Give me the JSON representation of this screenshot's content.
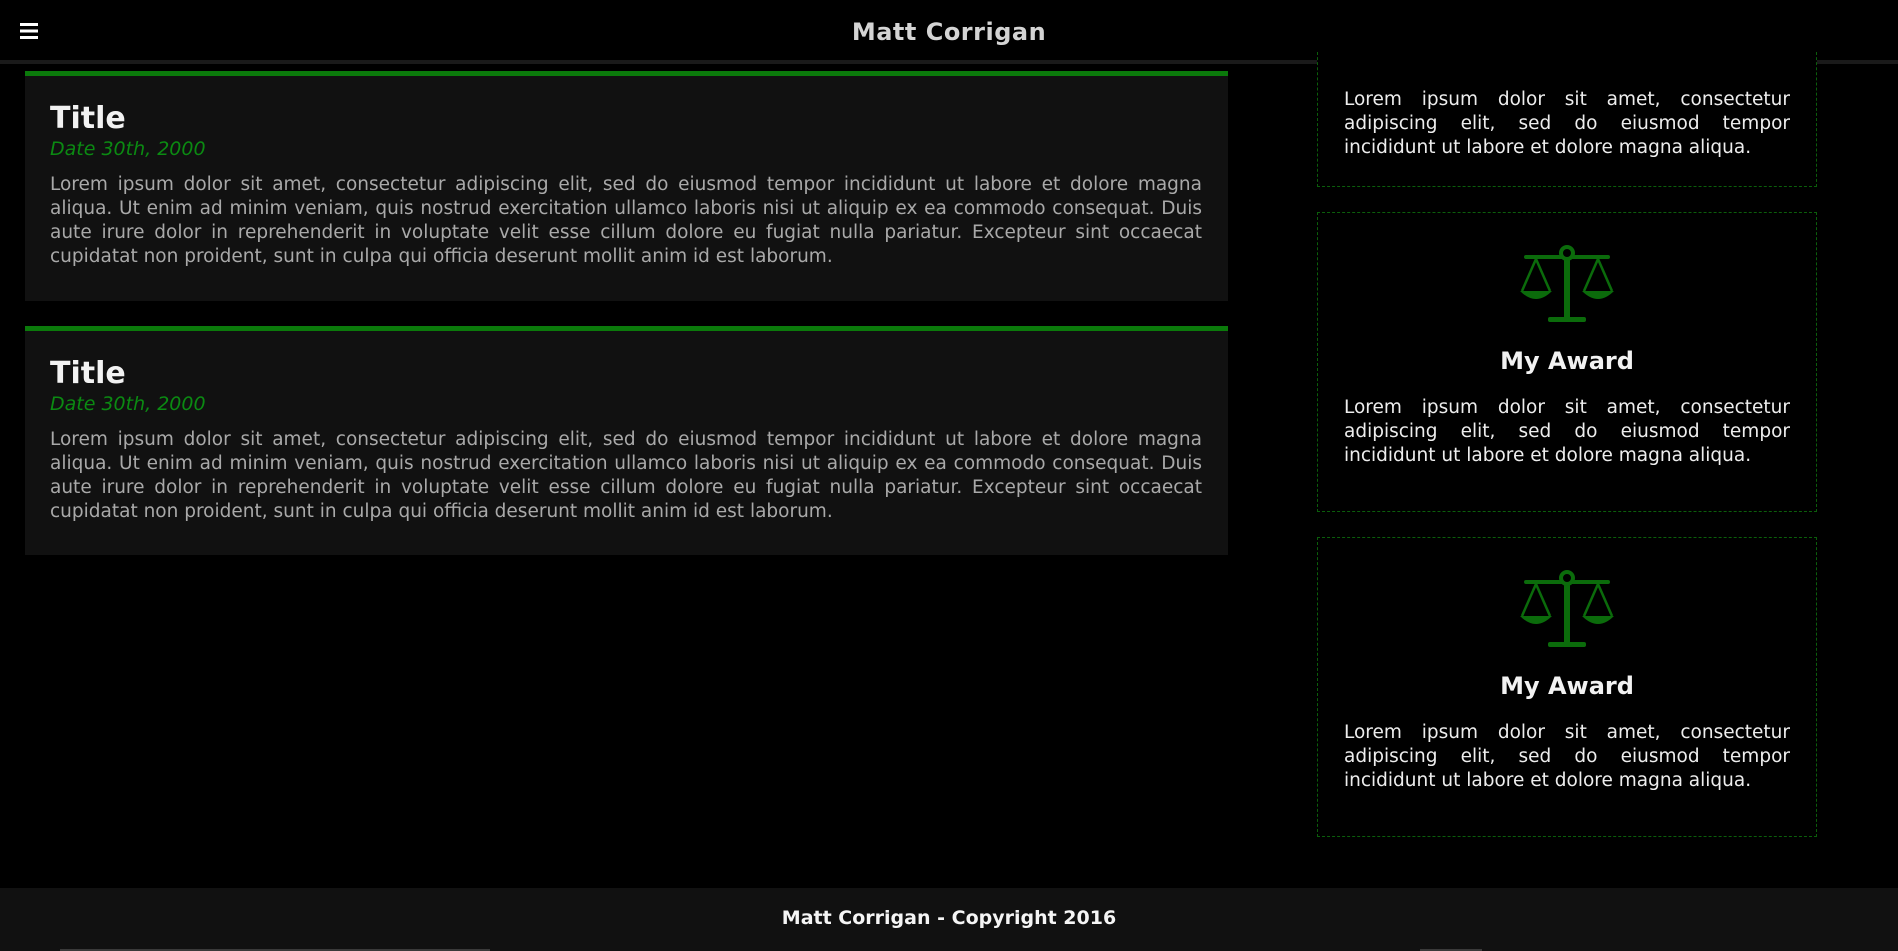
{
  "header": {
    "title": "Matt Corrigan",
    "menu_icon": "hamburger-menu-icon"
  },
  "posts": [
    {
      "title": "Title",
      "date": "Date 30th, 2000",
      "body": "Lorem ipsum dolor sit amet, consectetur adipiscing elit, sed do eiusmod tempor incididunt ut labore et dolore magna aliqua. Ut enim ad minim veniam, quis nostrud exercitation ullamco laboris nisi ut aliquip ex ea commodo consequat. Duis aute irure dolor in reprehenderit in voluptate velit esse cillum dolore eu fugiat nulla pariatur. Excepteur sint occaecat cupidatat non proident, sunt in culpa qui officia deserunt mollit anim id est laborum."
    },
    {
      "title": "Title",
      "date": "Date 30th, 2000",
      "body": "Lorem ipsum dolor sit amet, consectetur adipiscing elit, sed do eiusmod tempor incididunt ut labore et dolore magna aliqua. Ut enim ad minim veniam, quis nostrud exercitation ullamco laboris nisi ut aliquip ex ea commodo consequat. Duis aute irure dolor in reprehenderit in voluptate velit esse cillum dolore eu fugiat nulla pariatur. Excepteur sint occaecat cupidatat non proident, sunt in culpa qui officia deserunt mollit anim id est laborum."
    }
  ],
  "awards": [
    {
      "text": "Lorem ipsum dolor sit amet, consectetur adipiscing elit, sed do eiusmod tempor incididunt ut labore et dolore magna aliqua."
    },
    {
      "icon": "scales-icon",
      "title": "My Award",
      "text": "Lorem ipsum dolor sit amet, consectetur adipiscing elit, sed do eiusmod tempor incididunt ut labore et dolore magna aliqua."
    },
    {
      "icon": "scales-icon",
      "title": "My Award",
      "text": "Lorem ipsum dolor sit amet, consectetur adipiscing elit, sed do eiusmod tempor incididunt ut labore et dolore magna aliqua."
    }
  ],
  "footer": {
    "text": "Matt Corrigan - Copyright 2016"
  },
  "colors": {
    "accent": "#0b7a0b",
    "date": "#0b8a12",
    "background": "#000000",
    "card": "#111111"
  }
}
